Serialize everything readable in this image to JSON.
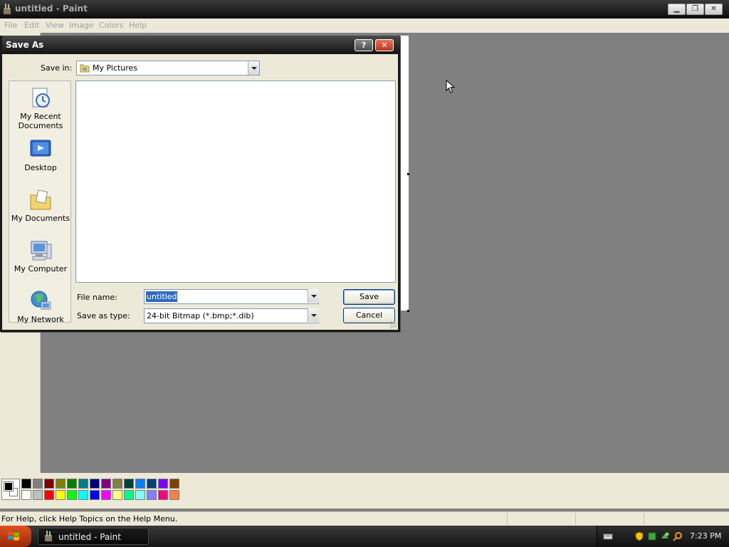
{
  "paint": {
    "title": "untitled - Paint",
    "menu": [
      "File",
      "Edit",
      "View",
      "Image",
      "Colors",
      "Help"
    ],
    "status_text": "For Help, click Help Topics on the Help Menu.",
    "palette_row1": [
      "#000000",
      "#808080",
      "#800000",
      "#808000",
      "#008000",
      "#008080",
      "#000080",
      "#800080",
      "#808040",
      "#004040",
      "#0080ff",
      "#004080",
      "#8000ff",
      "#804000"
    ],
    "palette_row2": [
      "#ffffff",
      "#c0c0c0",
      "#ff0000",
      "#ffff00",
      "#00ff00",
      "#00ffff",
      "#0000ff",
      "#ff00ff",
      "#ffff80",
      "#00ff80",
      "#80ffff",
      "#8080ff",
      "#ff0080",
      "#ff8040"
    ]
  },
  "dialog": {
    "title": "Save As",
    "help_glyph": "?",
    "close_glyph": "✕",
    "save_in_label": "Save in:",
    "save_in_value": "My Pictures",
    "places": [
      {
        "label": "My Recent Documents",
        "icon": "recent-documents-icon"
      },
      {
        "label": "Desktop",
        "icon": "desktop-icon"
      },
      {
        "label": "My Documents",
        "icon": "my-documents-icon"
      },
      {
        "label": "My Computer",
        "icon": "my-computer-icon"
      },
      {
        "label": "My Network",
        "icon": "my-network-icon"
      }
    ],
    "file_name_label": "File name:",
    "file_name_value": "untitled",
    "save_type_label": "Save as type:",
    "save_type_value": "24-bit Bitmap (*.bmp;*.dib)",
    "save_button": "Save",
    "cancel_button": "Cancel"
  },
  "taskbar": {
    "task_label": "untitled - Paint",
    "clock": "7:23 PM"
  }
}
